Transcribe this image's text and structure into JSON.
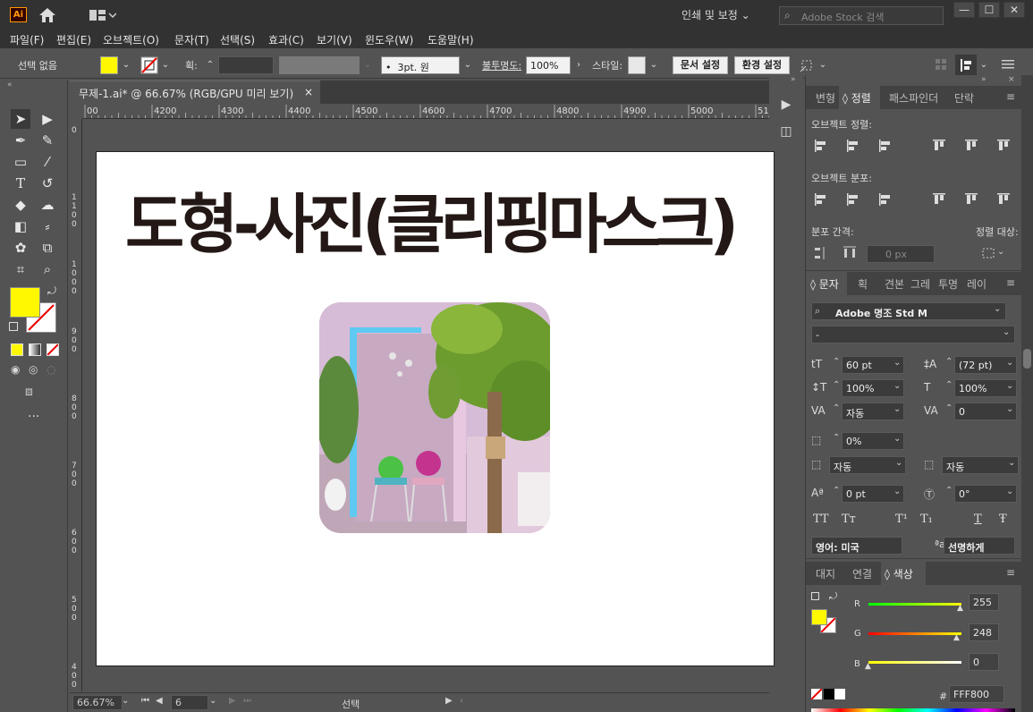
{
  "app": {
    "logo_text": "Ai",
    "workspace": "인쇄 및 보정",
    "stock_search_placeholder": "Adobe Stock 검색"
  },
  "menu": [
    "파일(F)",
    "편집(E)",
    "오브젝트(O)",
    "문자(T)",
    "선택(S)",
    "효과(C)",
    "보기(V)",
    "윈도우(W)",
    "도움말(H)"
  ],
  "control": {
    "selection": "선택 없음",
    "stroke_label": "획:",
    "brush": "3pt. 원",
    "opacity_label": "불투명도:",
    "opacity": "100%",
    "style_label": "스타일:",
    "doc_setup": "문서 설정",
    "preferences": "환경 설정",
    "fill_color": "#FFF800"
  },
  "document": {
    "tab_title": "무제-1.ai* @ 66.67% (RGB/GPU 미리 보기)",
    "ruler_top": [
      "00",
      "4200",
      "4300",
      "4400",
      "4500",
      "4600",
      "4700",
      "4800",
      "4900",
      "5000",
      "5100"
    ],
    "ruler_left": [
      "0",
      "1 1 0 0",
      "1 0 0 0",
      "9 0 0",
      "8 0 0",
      "7 0 0",
      "6 0 0",
      "5 0 0",
      "4 0 0"
    ],
    "art_title": "도형-사진(클리핑마스크)"
  },
  "status": {
    "zoom": "66.67%",
    "artboard": "6",
    "tool": "선택"
  },
  "align_panel": {
    "tabs": [
      "변형",
      "정렬",
      "패스파인더",
      "단락"
    ],
    "active_tab": "정렬",
    "object_align": "오브젝트 정렬:",
    "object_distribute": "오브젝트 분포:",
    "distribute_spacing": "분포 간격:",
    "align_to": "정렬 대상:",
    "spacing_value": "0 px"
  },
  "character_panel": {
    "tabs": [
      "문자",
      "획",
      "견본",
      "그레",
      "투명",
      "레이"
    ],
    "active_tab": "문자",
    "font_family": "Adobe 명조 Std M",
    "font_style": "-",
    "font_size": "60 pt",
    "leading": "(72 pt)",
    "vscale": "100%",
    "hscale": "100%",
    "kerning": "자동",
    "tracking": "0",
    "tsume": "0%",
    "aki_left": "자동",
    "aki_right": "자동",
    "baseline": "0 pt",
    "rotation": "0°",
    "language": "영어: 미국",
    "antialias": "선명하게",
    "caps": [
      "TT",
      "Tт",
      "T¹",
      "T₁",
      "T",
      "Ŧ"
    ]
  },
  "color_panel": {
    "tabs": [
      "대지",
      "연결",
      "색상"
    ],
    "active_tab": "색상",
    "r_label": "R",
    "g_label": "G",
    "b_label": "B",
    "r": 255,
    "g": 248,
    "b": 0,
    "hex_label": "#",
    "hex": "FFF800"
  }
}
